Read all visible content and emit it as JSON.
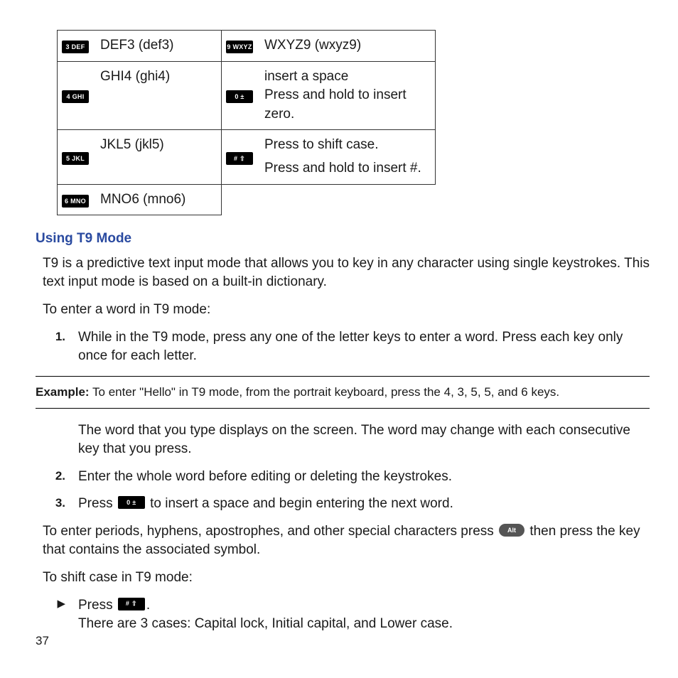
{
  "table": {
    "rows_left": [
      {
        "key": "3 DEF",
        "label": "DEF3 (def3)"
      },
      {
        "key": "4 GHI",
        "label": "GHI4 (ghi4)"
      },
      {
        "key": "5 JKL",
        "label": "JKL5 (jkl5)"
      },
      {
        "key": "6 MNO",
        "label": "MNO6 (mno6)"
      }
    ],
    "rows_right": [
      {
        "key": "9 WXYZ",
        "lines": [
          "WXYZ9 (wxyz9)"
        ]
      },
      {
        "key": "0 ±",
        "lines": [
          "insert a space",
          "Press and hold to insert zero."
        ]
      },
      {
        "key": "# ⇧",
        "lines": [
          "Press to shift case.",
          "Press and hold to insert #."
        ]
      }
    ]
  },
  "section_heading": "Using T9 Mode",
  "intro": "T9 is a predictive text input mode that allows you to key in any character using single keystrokes. This text input mode is based on a built-in dictionary.",
  "to_enter_word": "To enter a word in T9 mode:",
  "steps": {
    "s1": "While in the T9 mode, press any one of the letter keys to enter a word. Press each key only once for each letter.",
    "s1_cont": "The word that you type displays on the screen. The word may change with each consecutive key that you press.",
    "s2": "Enter the whole word before editing or deleting the keystrokes.",
    "s3_before": "Press ",
    "s3_after": " to insert a space and begin entering the next word."
  },
  "example": {
    "label": "Example:",
    "text": " To enter \"Hello\" in T9 mode, from the portrait keyboard, press the 4, 3, 5, 5, and 6 keys."
  },
  "special_before": "To enter periods, hyphens, apostrophes, and other special characters press ",
  "special_after": " then press the key that contains the associated symbol.",
  "alt_label": "Alt",
  "shift_intro": "To shift case in T9 mode:",
  "shift_press_before": "Press ",
  "shift_press_after": ".",
  "shift_cases": "There are 3 cases: Capital lock, Initial capital, and Lower case.",
  "icons": {
    "space": "0 ±",
    "hash": "# ⇧"
  },
  "page_number": "37"
}
